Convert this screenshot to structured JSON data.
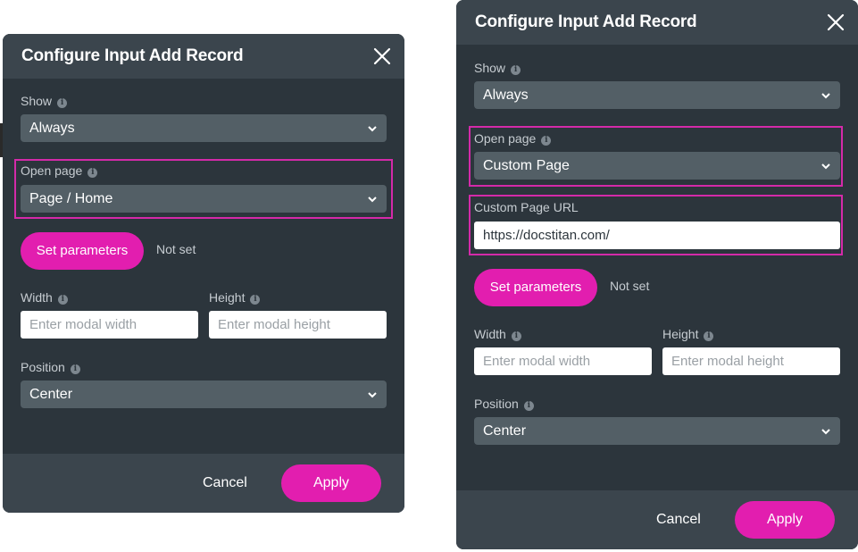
{
  "left_dialog": {
    "title": "Configure Input Add Record",
    "show_label": "Show",
    "show_value": "Always",
    "open_page_label": "Open page",
    "open_page_value": "Page / Home",
    "set_parameters_label": "Set parameters",
    "parameters_status": "Not set",
    "width_label": "Width",
    "width_placeholder": "Enter modal width",
    "height_label": "Height",
    "height_placeholder": "Enter modal height",
    "position_label": "Position",
    "position_value": "Center",
    "cancel_label": "Cancel",
    "apply_label": "Apply"
  },
  "right_dialog": {
    "title": "Configure Input Add Record",
    "show_label": "Show",
    "show_value": "Always",
    "open_page_label": "Open page",
    "open_page_value": "Custom Page",
    "custom_url_label": "Custom Page URL",
    "custom_url_value": "https://docstitan.com/",
    "set_parameters_label": "Set parameters",
    "parameters_status": "Not set",
    "width_label": "Width",
    "width_placeholder": "Enter modal width",
    "height_label": "Height",
    "height_placeholder": "Enter modal height",
    "position_label": "Position",
    "position_value": "Center",
    "cancel_label": "Cancel",
    "apply_label": "Apply"
  },
  "icons": {
    "info": "i",
    "close": "close-icon",
    "dropdown": "chevron-down-icon"
  },
  "colors": {
    "accent": "#e21eaf",
    "highlight": "#d42aa9",
    "dialog_bg": "#2c353c",
    "header_bg": "#3b454d",
    "select_bg": "#535f66"
  }
}
